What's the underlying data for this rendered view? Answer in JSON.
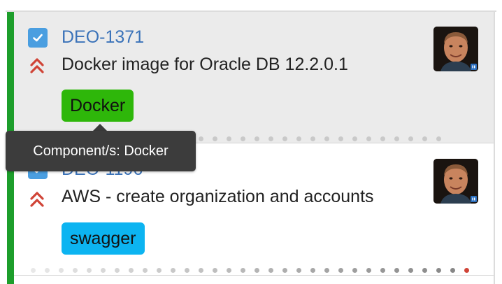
{
  "board": {
    "swimlane_color": "#1d9e2b",
    "cards": [
      {
        "key": "DEO-1371",
        "summary": "Docker image for Oracle DB 12.2.0.1",
        "label": "Docker",
        "label_color": "#2eb70a",
        "issue_type_icon": "check-icon",
        "priority_icon": "priority-highest-icon",
        "selected": true,
        "assignee_avatar": "avatar-icon"
      },
      {
        "key": "DEO-1196",
        "summary": "AWS - create organization and accounts",
        "label": "swagger",
        "label_color": "#0cb4f1",
        "issue_type_icon": "check-icon",
        "priority_icon": "priority-highest-icon",
        "selected": false,
        "assignee_avatar": "avatar-icon"
      }
    ]
  },
  "tooltip": {
    "text": "Component/s: Docker"
  }
}
